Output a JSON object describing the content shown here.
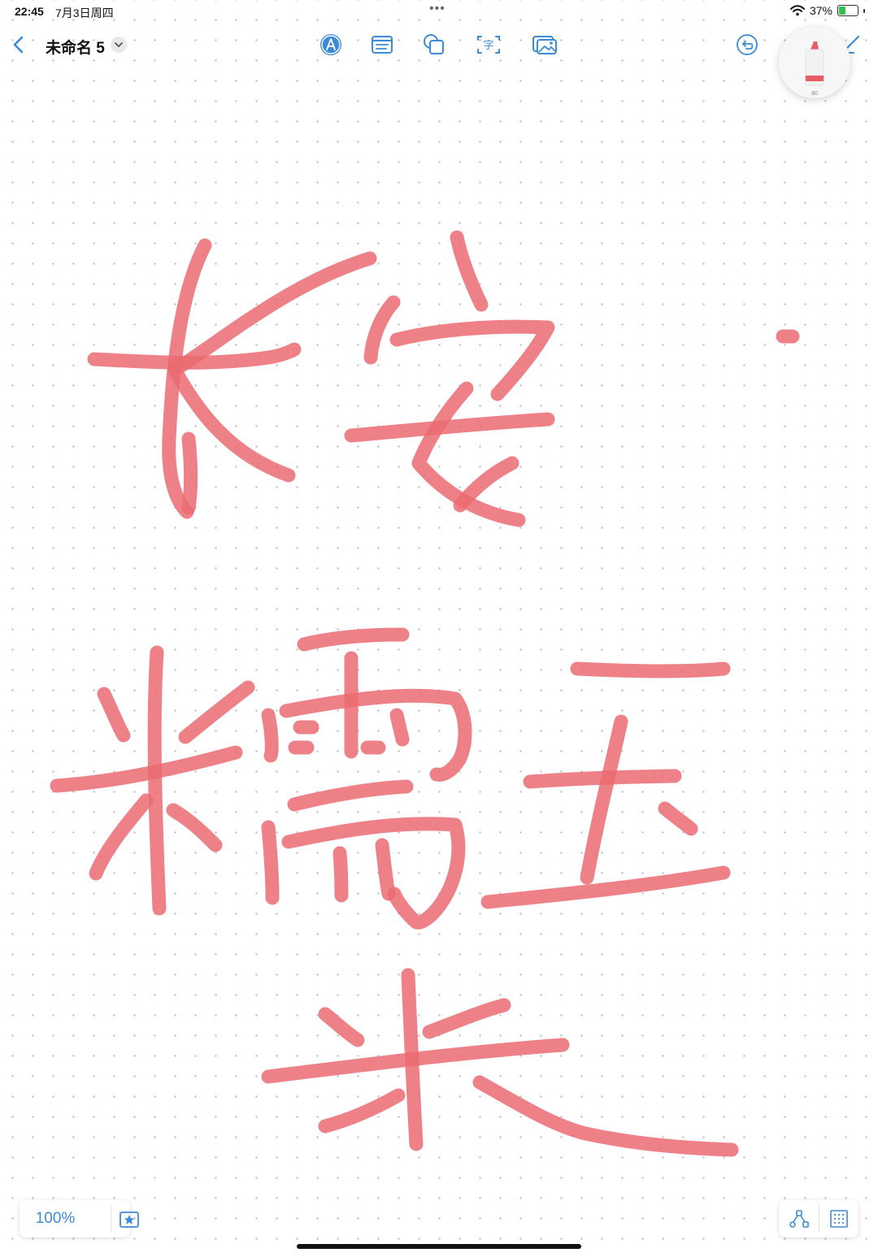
{
  "status_bar": {
    "time": "22:45",
    "date": "7月3日周四",
    "battery": "37%",
    "battery_level": 0.37
  },
  "toolbar": {
    "title": "未命名 5",
    "icons": [
      "back-chevron-icon",
      "pen-tool-icon",
      "text-box-icon",
      "shapes-icon",
      "text-recognition-icon",
      "image-icon",
      "undo-icon",
      "edit-icon"
    ]
  },
  "pen": {
    "size_label": "80",
    "color": "#e85c64"
  },
  "handwriting": {
    "color": "#ea6b72"
  },
  "bottom_bar": {
    "zoom": "100%"
  },
  "colors": {
    "accent": "#3b8bd8",
    "ink": "#ea6b72"
  }
}
